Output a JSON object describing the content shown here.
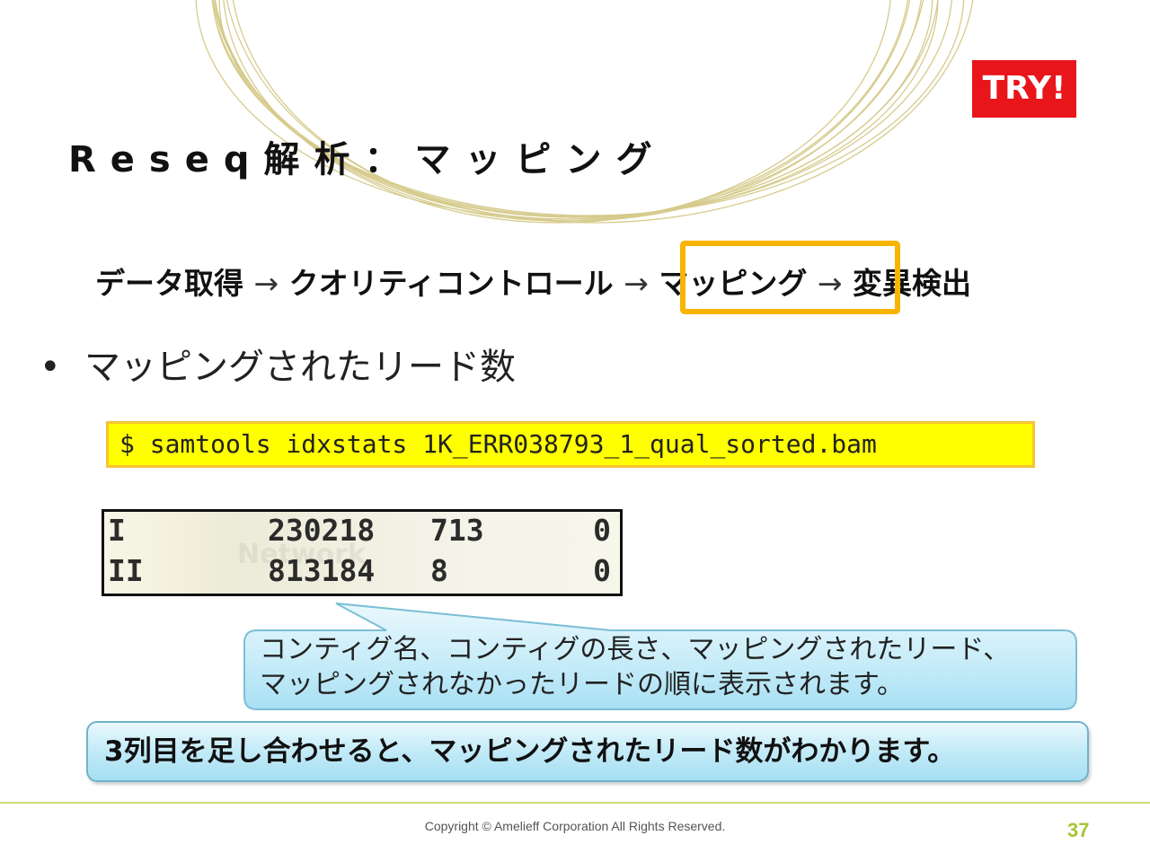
{
  "badge": {
    "label": "TRY!",
    "color": "#e8151b"
  },
  "title": "Reseq解析：マッピング",
  "pipeline": {
    "steps": [
      "データ取得",
      "クオリティコントロール",
      "マッピング",
      "変異検出"
    ],
    "arrow": "→",
    "highlighted_step": "マッピング",
    "highlight_color": "#f8b400"
  },
  "bullet": {
    "text": "マッピングされたリード数"
  },
  "command": {
    "text": "$ samtools idxstats 1K_ERR038793_1_qual_sorted.bam",
    "background": "#ffff00"
  },
  "output_table": {
    "rows": [
      [
        "I",
        "230218",
        "713",
        "0"
      ],
      [
        "II",
        "813184",
        "8",
        "0"
      ]
    ],
    "watermark": "Network"
  },
  "callout": {
    "lines": [
      "コンティグ名、コンティグの長さ、マッピングされたリード、",
      "マッピングされなかったリードの順に表示されます。"
    ]
  },
  "summary": {
    "text": "3列目を足し合わせると、マッピングされたリード数がわかります。"
  },
  "footer": {
    "copyright": "Copyright © Amelieff Corporation All Rights Reserved.",
    "page_number": "37",
    "accent": "#a9c534"
  }
}
